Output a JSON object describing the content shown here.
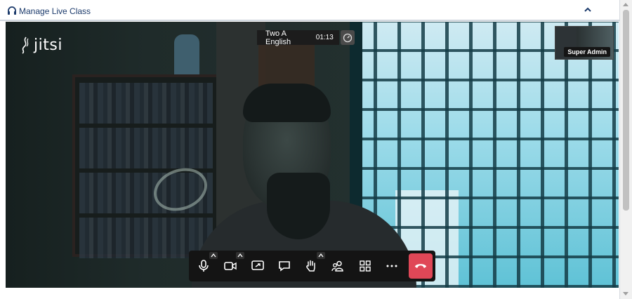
{
  "panel": {
    "title": "Manage Live Class",
    "header_icon": "headphones-icon",
    "collapse_icon": "chevron-up-icon",
    "accent_color": "#1b3a6b"
  },
  "meeting": {
    "logo_text": "jitsi",
    "title": "Two A English",
    "timer": "01:13",
    "participant_name": "Super Admin"
  },
  "toolbar": {
    "buttons": [
      {
        "name": "microphone-icon",
        "has_caret": true
      },
      {
        "name": "camera-icon",
        "has_caret": true
      },
      {
        "name": "screen-share-icon",
        "has_caret": false
      },
      {
        "name": "chat-icon",
        "has_caret": false
      },
      {
        "name": "raise-hand-icon",
        "has_caret": true
      },
      {
        "name": "participants-icon",
        "has_caret": false
      },
      {
        "name": "tile-view-icon",
        "has_caret": false
      },
      {
        "name": "more-options-icon",
        "has_caret": false
      },
      {
        "name": "hangup-icon",
        "has_caret": false
      }
    ],
    "hangup_color": "#e04757"
  }
}
